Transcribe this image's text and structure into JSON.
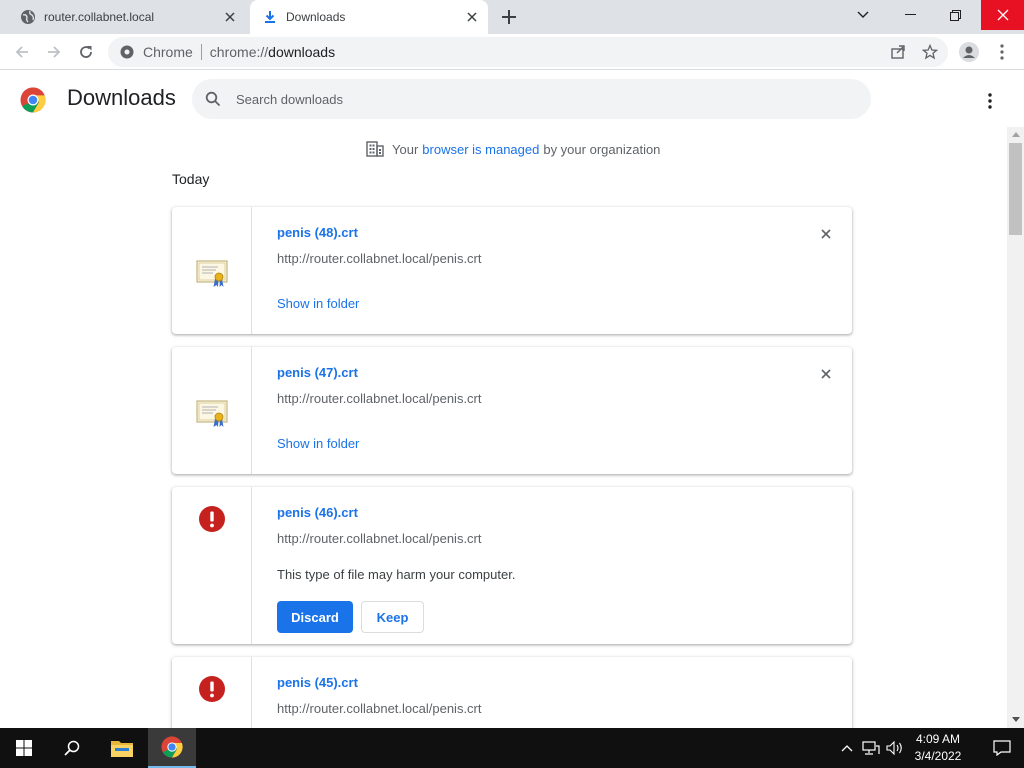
{
  "tabs": [
    {
      "title": "router.collabnet.local",
      "active": false,
      "icon": "globe-icon"
    },
    {
      "title": "Downloads",
      "active": true,
      "icon": "download-icon"
    }
  ],
  "toolbar": {
    "scheme_label": "Chrome",
    "url_prefix": "chrome://",
    "url_path": "downloads"
  },
  "page": {
    "title": "Downloads",
    "search_placeholder": "Search downloads",
    "managed_prefix": "Your",
    "managed_link": "browser is managed",
    "managed_suffix": "by your organization",
    "section_date": "Today"
  },
  "downloads": [
    {
      "name": "penis (48).crt",
      "url": "http://router.collabnet.local/penis.crt",
      "action": "Show in folder",
      "state": "complete"
    },
    {
      "name": "penis (47).crt",
      "url": "http://router.collabnet.local/penis.crt",
      "action": "Show in folder",
      "state": "complete"
    },
    {
      "name": "penis (46).crt",
      "url": "http://router.collabnet.local/penis.crt",
      "warning": "This type of file may harm your computer.",
      "discard_label": "Discard",
      "keep_label": "Keep",
      "state": "dangerous"
    },
    {
      "name": "penis (45).crt",
      "url": "http://router.collabnet.local/penis.crt",
      "state": "dangerous"
    }
  ],
  "taskbar": {
    "time": "4:09 AM",
    "date": "3/4/2022"
  },
  "colors": {
    "accent": "#1a73e8",
    "danger": "#c5221f",
    "tabstrip": "#dee1e6",
    "close_hover": "#e81123"
  }
}
